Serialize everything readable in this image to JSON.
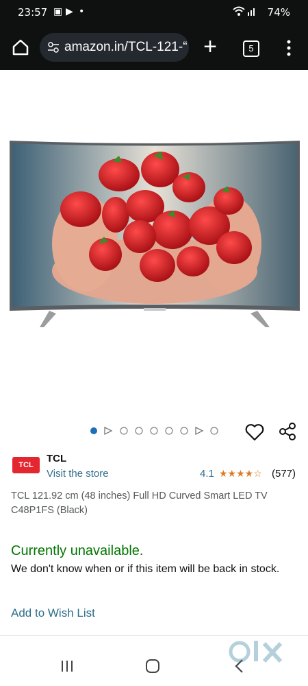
{
  "status_bar": {
    "time": "23:57",
    "battery": "74%"
  },
  "browser": {
    "url": "amazon.in/TCL-121-“",
    "tab_count": "5"
  },
  "gallery": {
    "dot_count": 9,
    "active_index": 0
  },
  "product": {
    "brand_logo_text": "TCL",
    "brand": "TCL",
    "store_link": "Visit the store",
    "rating": "4.1",
    "stars": "★★★★☆",
    "review_count": "(577)",
    "title": "TCL 121.92 cm (48 inches) Full HD Curved Smart LED TV C48P1FS (Black)"
  },
  "availability": {
    "status": "Currently unavailable.",
    "description": "We don't know when or if this item will be back in stock."
  },
  "actions": {
    "wishlist": "Add to Wish List"
  },
  "colors": {
    "link": "#2e6e8a",
    "available_green": "#007600",
    "chrome_bg": "#0f1111",
    "star": "#de7921",
    "brand_red": "#e3262f"
  }
}
